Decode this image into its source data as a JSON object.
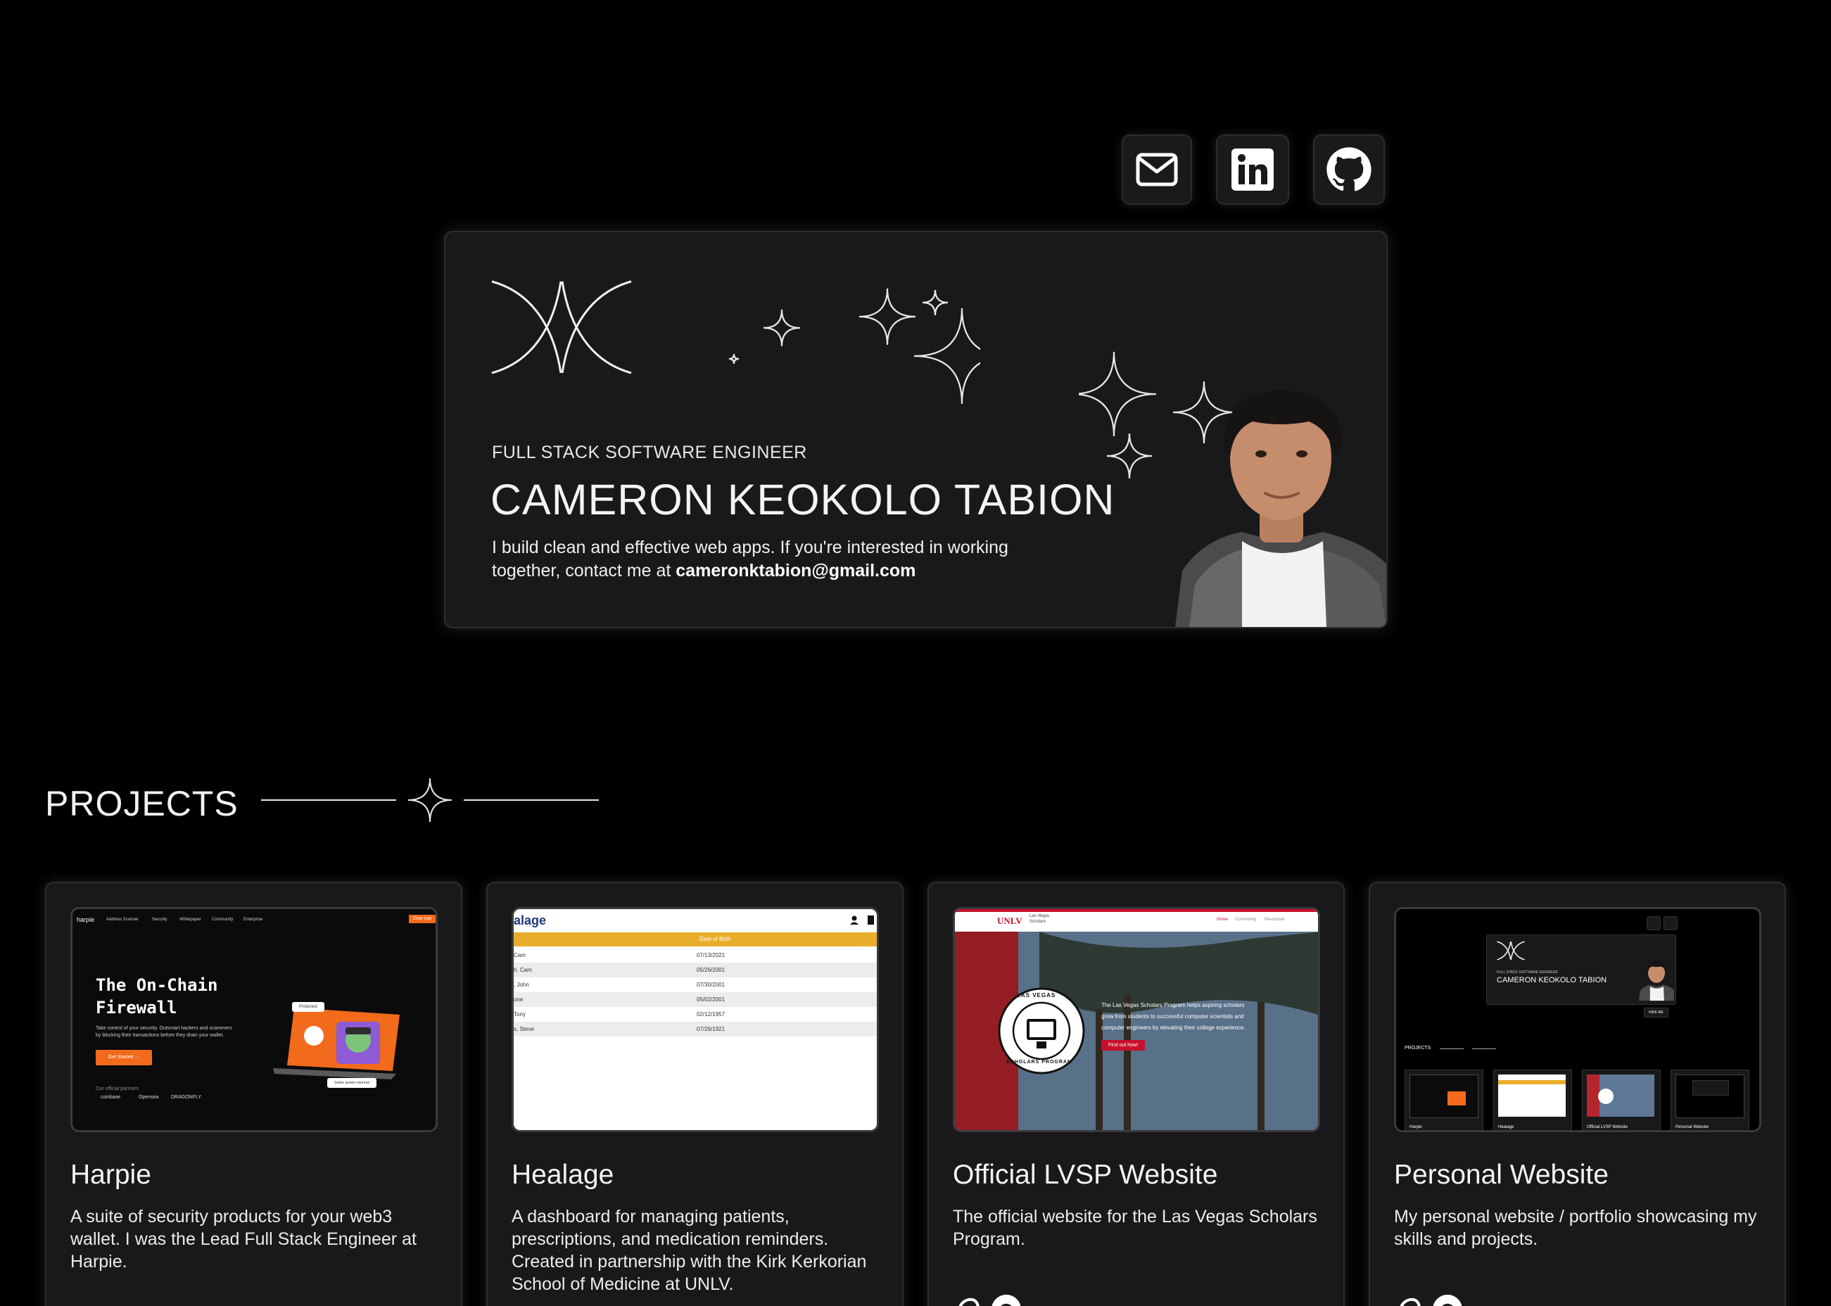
{
  "socials": [
    {
      "name": "email",
      "icon": "mail-icon"
    },
    {
      "name": "linkedin",
      "icon": "linkedin-icon"
    },
    {
      "name": "github",
      "icon": "github-icon"
    }
  ],
  "hero": {
    "role": "FULL STACK SOFTWARE ENGINEER",
    "name": "CAMERON KEOKOLO TABION",
    "desc_prefix": "I build clean and effective web apps. If you're interested in working together, contact me at ",
    "email": "cameronktabion@gmail.com"
  },
  "projects": {
    "heading": "PROJECTS",
    "items": [
      {
        "title": "Harpie",
        "desc": "A suite of security products for your web3 wallet. I was the Lead Full Stack Engineer at Harpie.",
        "shot": {
          "brand": "harpie",
          "nav": [
            "Address Scanner",
            "Security",
            "Whitepaper",
            "Community",
            "Enterprise"
          ],
          "cta": "Enter App",
          "headline_1": "The On-Chain",
          "headline_2": "Firewall",
          "sub_1": "Take control of your security. Outsmart hackers and scammers",
          "sub_2": "by blocking their transactions before they drain your wallet.",
          "button": "Get Started →",
          "partners_label": "Our official partners",
          "partners": [
            "coinbase",
            "Opensea",
            "DRAGONFLY"
          ],
          "badge": "Protected",
          "alert": "Stolen assets returned"
        }
      },
      {
        "title": "Healage",
        "desc": "A dashboard for managing patients, prescriptions, and medication reminders. Created in partnership with the Kirk Kerkorian School of Medicine at UNLV.",
        "shot": {
          "brand": "alage",
          "column": "Date of Birth",
          "rows": [
            {
              "name": "Cam",
              "dob": "07/13/2021"
            },
            {
              "name": "h, Cam",
              "dob": "05/26/2001"
            },
            {
              "name": ", John",
              "dob": "07/30/2001"
            },
            {
              "name": "one",
              "dob": "05/02/2001"
            },
            {
              "name": "Tony",
              "dob": "02/12/1957"
            },
            {
              "name": "s, Steve",
              "dob": "07/26/1921"
            }
          ]
        }
      },
      {
        "title": "Official LVSP Website",
        "desc": "The official website for the Las Vegas Scholars Program.",
        "shot": {
          "brand": "UNLV",
          "brand_sub_1": "Las Vegas",
          "brand_sub_2": "Scholars",
          "nav": [
            "Home",
            "Community",
            "Resources"
          ],
          "seal_top": "LAS VEGAS",
          "seal_bottom": "SCHOLARS PROGRAM",
          "copy_1": "The Las Vegas Scholars Program helps aspiring scholars",
          "copy_2": "grow from students to successful computer scientists and",
          "copy_3": "computer engineers by elevating their college experience.",
          "button": "Find out how!"
        }
      },
      {
        "title": "Personal Website",
        "desc": "My personal website / portfolio showcasing my skills and projects.",
        "shot": {
          "role": "FULL STACK SOFTWARE ENGINEER",
          "name": "CAMERON KEOKOLO TABION",
          "hire": "HIRE ME",
          "heading": "PROJECTS",
          "thumbs": [
            "Harpie",
            "Healage",
            "Official LVSP Website",
            "Personal Website"
          ]
        }
      }
    ]
  },
  "colors": {
    "background": "#000000",
    "card": "#19191b",
    "border": "#2d2d30",
    "harpie_orange": "#f26a1b",
    "healage_yellow": "#e8ae2b",
    "unlv_red": "#c8102e"
  }
}
